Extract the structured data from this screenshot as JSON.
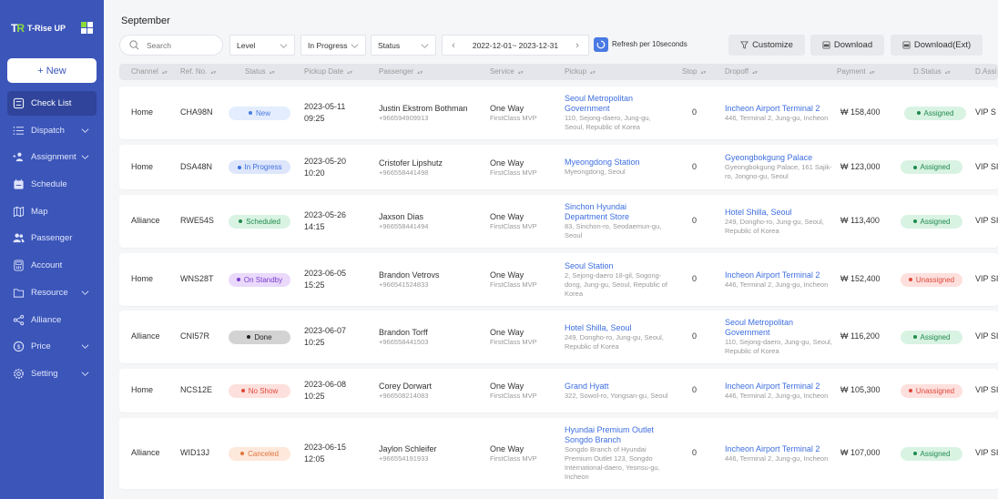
{
  "app": {
    "logo_mark": "TR",
    "logo_text": "T-Rise UP"
  },
  "sidebar": {
    "new_label": "+ New",
    "items": [
      {
        "label": "Check List",
        "icon": "checklist-icon",
        "active": true,
        "chevron": false
      },
      {
        "label": "Dispatch",
        "icon": "list-icon",
        "active": false,
        "chevron": true
      },
      {
        "label": "Assignment",
        "icon": "user-add-icon",
        "active": false,
        "chevron": true
      },
      {
        "label": "Schedule",
        "icon": "calendar-icon",
        "active": false,
        "chevron": false
      },
      {
        "label": "Map",
        "icon": "map-icon",
        "active": false,
        "chevron": false
      },
      {
        "label": "Passenger",
        "icon": "users-icon",
        "active": false,
        "chevron": false
      },
      {
        "label": "Account",
        "icon": "account-icon",
        "active": false,
        "chevron": false
      },
      {
        "label": "Resource",
        "icon": "folder-icon",
        "active": false,
        "chevron": true
      },
      {
        "label": "Alliance",
        "icon": "share-icon",
        "active": false,
        "chevron": false
      },
      {
        "label": "Price",
        "icon": "price-icon",
        "active": false,
        "chevron": true
      },
      {
        "label": "Setting",
        "icon": "gear-icon",
        "active": false,
        "chevron": true
      }
    ]
  },
  "header": {
    "title": "September"
  },
  "toolbar": {
    "search_placeholder": "Search",
    "level_label": "Level",
    "progress_label": "In Progress",
    "status_label": "Status",
    "date_range": "2022-12-01~ 2023-12-31",
    "refresh_label": "Refresh per 10seconds",
    "customize_label": "Customize",
    "download_label": "Download",
    "download_ext_label": "Download(Ext)"
  },
  "table": {
    "columns": [
      "Channel",
      "Ref. No.",
      "Status",
      "Pickup Date",
      "Passenger",
      "Service",
      "Pickup",
      "Stop",
      "Dropoff",
      "Payment",
      "D.Status",
      "D.Assi"
    ],
    "rows": [
      {
        "channel": "Home",
        "ref": "CHA98N",
        "status": "New",
        "date": "2023-05-11",
        "time": "09:25",
        "passenger": "Justin Ekstrom Bothman",
        "phone": "+966594909913",
        "service": "One Way",
        "service_class": "FirstClass MVP",
        "pickup_name": "Seoul Metropolitan Government",
        "pickup_addr": "110, Sejong-daero, Jung-gu, Seoul, Republic of Korea",
        "stop": "0",
        "dropoff_name": "Incheon Airport Terminal 2",
        "dropoff_addr": "446, Terminal 2, Jung-gu, Incheon",
        "payment": "₩ 158,400",
        "d_status": "Assigned",
        "d_assign": "VIP S"
      },
      {
        "channel": "Home",
        "ref": "DSA48N",
        "status": "In Progress",
        "date": "2023-05-20",
        "time": "10:20",
        "passenger": "Cristofer Lipshutz",
        "phone": "+966558441498",
        "service": "One Way",
        "service_class": "FirstClass MVP",
        "pickup_name": "Myeongdong Station",
        "pickup_addr": "Myeongdong, Seoul",
        "stop": "0",
        "dropoff_name": "Gyeongbokgung Palace",
        "dropoff_addr": "Gyeongbokgung Palace, 161 Sajik-ro, Jongno-gu, Seoul",
        "payment": "₩ 123,000",
        "d_status": "Assigned",
        "d_assign": "VIP SI"
      },
      {
        "channel": "Alliance",
        "ref": "RWE54S",
        "status": "Scheduled",
        "date": "2023-05-26",
        "time": "14:15",
        "passenger": "Jaxson Dias",
        "phone": "+966558441494",
        "service": "One Way",
        "service_class": "FirstClass MVP",
        "pickup_name": "Sinchon Hyundai Department Store",
        "pickup_addr": "83, Sinchon-ro, Seodaemun-gu, Seoul",
        "stop": "0",
        "dropoff_name": "Hotel Shilla, Seoul",
        "dropoff_addr": "249, Dongho-ro, Jung-gu, Seoul, Republic of Korea",
        "payment": "₩ 113,400",
        "d_status": "Assigned",
        "d_assign": "VIP SI"
      },
      {
        "channel": "Home",
        "ref": "WNS28T",
        "status": "On Standby",
        "date": "2023-06-05",
        "time": "15:25",
        "passenger": "Brandon Vetrovs",
        "phone": "+966541524833",
        "service": "One Way",
        "service_class": "FirstClass MVP",
        "pickup_name": "Seoul Station",
        "pickup_addr": "2, Sejong-daero 18-gil, Sogong-dong, Jung-gu, Seoul, Republic of Korea",
        "stop": "0",
        "dropoff_name": "Incheon Airport Terminal 2",
        "dropoff_addr": "446, Terminal 2, Jung-gu, Incheon",
        "payment": "₩ 152,400",
        "d_status": "Unassigned",
        "d_assign": "VIP SI"
      },
      {
        "channel": "Alliance",
        "ref": "CNI57R",
        "status": "Done",
        "date": "2023-06-07",
        "time": "10:25",
        "passenger": "Brandon Torff",
        "phone": "+966558441503",
        "service": "One Way",
        "service_class": "FirstClass MVP",
        "pickup_name": "Hotel Shilla, Seoul",
        "pickup_addr": "249, Dongho-ro, Jung-gu, Seoul, Republic of Korea",
        "stop": "0",
        "dropoff_name": "Seoul Metropolitan Government",
        "dropoff_addr": "110, Sejong-daero, Jung-gu, Seoul, Republic of Korea",
        "payment": "₩ 116,200",
        "d_status": "Assigned",
        "d_assign": "VIP SI"
      },
      {
        "channel": "Home",
        "ref": "NCS12E",
        "status": "No Show",
        "date": "2023-06-08",
        "time": "10:25",
        "passenger": "Corey Dorwart",
        "phone": "+966508214083",
        "service": "One Way",
        "service_class": "FirstClass MVP",
        "pickup_name": "Grand Hyatt",
        "pickup_addr": "322, Sowol-ro, Yongsan-gu, Seoul",
        "stop": "0",
        "dropoff_name": "Incheon Airport Terminal 2",
        "dropoff_addr": "446, Terminal 2, Jung-gu, Incheon",
        "payment": "₩ 105,300",
        "d_status": "Unassigned",
        "d_assign": "VIP SI"
      },
      {
        "channel": "Alliance",
        "ref": "WID13J",
        "status": "Canceled",
        "date": "2023-06-15",
        "time": "12:05",
        "passenger": "Jaylon Schleifer",
        "phone": "+966554191933",
        "service": "One Way",
        "service_class": "FirstClass MVP",
        "pickup_name": "Hyundai Premium Outlet Songdo Branch",
        "pickup_addr": "Songdo Branch of Hyundai Premium Outlet 123, Songdo International-daero, Yeonsu-gu, Incheon",
        "stop": "0",
        "dropoff_name": "Incheon Airport Terminal 2",
        "dropoff_addr": "446, Terminal 2, Jung-gu, Incheon",
        "payment": "₩ 107,000",
        "d_status": "Assigned",
        "d_assign": "VIP SI"
      }
    ]
  },
  "status_colors": {
    "New": {
      "bg": "#e3edfd",
      "fg": "#4a7ae3"
    },
    "In Progress": {
      "bg": "#dde6fb",
      "fg": "#3d6ee0"
    },
    "Scheduled": {
      "bg": "#d9f3e3",
      "fg": "#1f8a4c"
    },
    "On Standby": {
      "bg": "#ead9fb",
      "fg": "#7a3fd0"
    },
    "Done": {
      "bg": "#d3d3d3",
      "fg": "#222222"
    },
    "No Show": {
      "bg": "#fde0dd",
      "fg": "#e0483b"
    },
    "Canceled": {
      "bg": "#fde8db",
      "fg": "#e0753b"
    },
    "Assigned": {
      "bg": "#d9f3e3",
      "fg": "#1f8a4c"
    },
    "Unassigned": {
      "bg": "#fde0dd",
      "fg": "#e0483b"
    }
  },
  "colors": {
    "sidebar": "#3b55b9",
    "accent": "#4a7ae3",
    "link": "#3d6ee0"
  }
}
